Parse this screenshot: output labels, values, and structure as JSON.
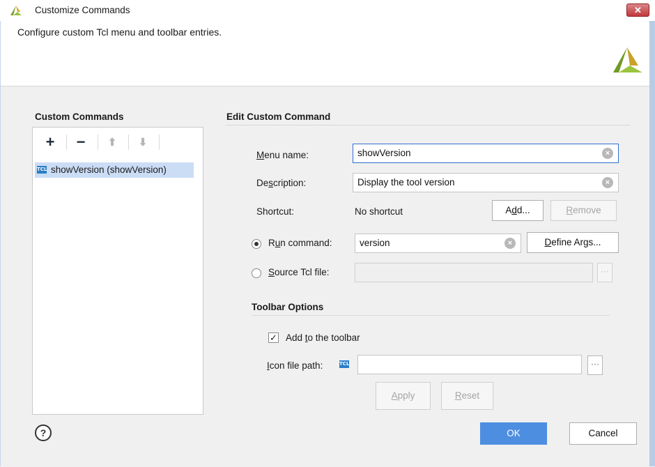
{
  "window": {
    "title": "Customize Commands",
    "close_glyph": "✕"
  },
  "header": {
    "description": "Configure custom Tcl menu and toolbar entries."
  },
  "left": {
    "title": "Custom Commands",
    "toolbar": {
      "add": "+",
      "remove": "−",
      "up": "⬆",
      "down": "⬇"
    },
    "items": [
      {
        "badge": "TCL",
        "label": "showVersion (showVersion)"
      }
    ]
  },
  "edit": {
    "title": "Edit Custom Command",
    "menu_name_label": "Menu name:",
    "menu_name_value": "showVersion",
    "description_label": "Description:",
    "description_value": "Display the tool version",
    "shortcut_label": "Shortcut:",
    "shortcut_value": "No shortcut",
    "add_button": "Add...",
    "remove_button": "Remove",
    "run_command_label": "Run command:",
    "run_command_value": "version",
    "define_args_button": "Define Args...",
    "source_tcl_label": "Source Tcl file:",
    "source_tcl_value": "",
    "browse_glyph": "···"
  },
  "toolbar_options": {
    "title": "Toolbar Options",
    "add_to_toolbar_label": "Add to the toolbar",
    "add_to_toolbar_checked": true,
    "icon_path_label": "Icon file path:",
    "icon_badge": "TCL",
    "icon_path_value": "",
    "apply_button": "Apply",
    "reset_button": "Reset"
  },
  "footer": {
    "help_glyph": "?",
    "ok_button": "OK",
    "cancel_button": "Cancel"
  },
  "colors": {
    "accent": "#4d8ee0",
    "selection": "#cbdcf5",
    "close": "#c2383c",
    "logo": "#8db33a"
  }
}
